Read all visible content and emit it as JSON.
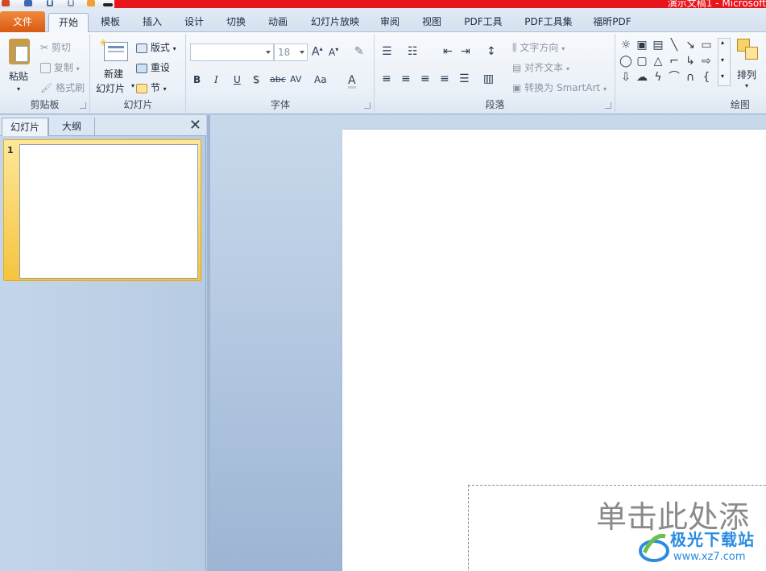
{
  "window": {
    "title": "演示文稿1 - Microsoft"
  },
  "tabs": {
    "file": "文件",
    "items": [
      "开始",
      "模板",
      "插入",
      "设计",
      "切换",
      "动画",
      "幻灯片放映",
      "审阅",
      "视图",
      "PDF工具",
      "PDF工具集",
      "福昕PDF"
    ]
  },
  "ribbon": {
    "clipboard": {
      "label": "剪贴板",
      "paste": "粘贴",
      "cut": "剪切",
      "copy": "复制",
      "format_painter": "格式刷"
    },
    "slides": {
      "label": "幻灯片",
      "new_slide_line1": "新建",
      "new_slide_line2": "幻灯片",
      "layout": "版式",
      "reset": "重设",
      "section": "节"
    },
    "font": {
      "label": "字体",
      "font_name": "",
      "font_size": "18",
      "bold": "B",
      "italic": "I",
      "underline": "U",
      "shadow": "S",
      "strike": "abc",
      "spacing": "AV",
      "case": "Aa",
      "color": "A"
    },
    "paragraph": {
      "label": "段落",
      "text_direction": "文字方向",
      "align_text": "对齐文本",
      "convert_smartart": "转换为 SmartArt"
    },
    "drawing": {
      "label": "绘图",
      "arrange": "排列"
    }
  },
  "pane": {
    "tab_slides": "幻灯片",
    "tab_outline": "大纲",
    "close": "✕",
    "slide_number": "1"
  },
  "slide": {
    "placeholder": "单击此处添"
  },
  "watermark": {
    "title": "极光下载站",
    "url": "www.xz7.com"
  }
}
